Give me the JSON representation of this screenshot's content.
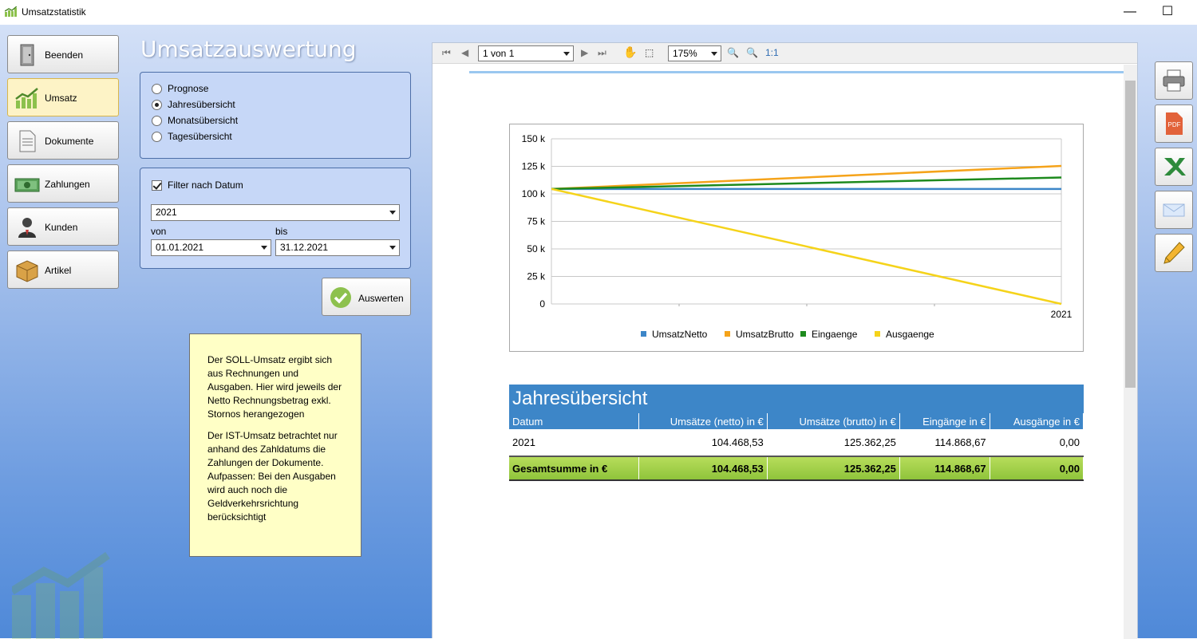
{
  "window": {
    "title": "Umsatzstatistik",
    "minimize_glyph": "—",
    "maximize_glyph": "☐"
  },
  "nav": {
    "items": [
      {
        "label": "Beenden",
        "icon": "exit-door-icon"
      },
      {
        "label": "Umsatz",
        "icon": "revenue-chart-icon"
      },
      {
        "label": "Dokumente",
        "icon": "document-icon"
      },
      {
        "label": "Zahlungen",
        "icon": "money-icon"
      },
      {
        "label": "Kunden",
        "icon": "user-icon"
      },
      {
        "label": "Artikel",
        "icon": "box-icon"
      }
    ]
  },
  "main": {
    "heading": "Umsatzauswertung",
    "report_type": {
      "options": [
        "Prognose",
        "Jahresübersicht",
        "Monatsübersicht",
        "Tagesübersicht"
      ],
      "selected": "Jahresübersicht"
    },
    "filter": {
      "checkbox_label": "Filter nach Datum",
      "checked": true,
      "year": "2021",
      "from_label": "von",
      "from_value": "01.01.2021",
      "to_label": "bis",
      "to_value": "31.12.2021"
    },
    "evaluate_label": "Auswerten",
    "note": {
      "p1": "Der SOLL-Umsatz ergibt sich aus Rechnungen und Ausgaben. Hier wird jeweils der Netto Rechnungsbetrag exkl. Stornos herangezogen",
      "p2": "Der IST-Umsatz betrachtet nur anhand des Zahldatums die Zahlungen der Dokumente. Aufpassen: Bei den Ausgaben wird auch noch die Geldverkehrsrichtung berücksichtigt"
    }
  },
  "viewer": {
    "page_indicator": "1 von 1",
    "zoom": "175%",
    "one_to_one": "1:1"
  },
  "chart_data": {
    "type": "line",
    "x": [
      "",
      "2021"
    ],
    "series": [
      {
        "name": "UmsatzNetto",
        "color": "#3d86c8",
        "values": [
          104468.53,
          104468.53
        ]
      },
      {
        "name": "UmsatzBrutto",
        "color": "#f5a31a",
        "values": [
          104468.53,
          125362.25
        ]
      },
      {
        "name": "Eingaenge",
        "color": "#1d8a1d",
        "values": [
          104468.53,
          114868.67
        ]
      },
      {
        "name": "Ausgaenge",
        "color": "#f5d31a",
        "values": [
          104468.53,
          0
        ]
      }
    ],
    "yticks": [
      "150 k",
      "125 k",
      "100 k",
      "75 k",
      "50 k",
      "25 k",
      "0"
    ],
    "ylim": [
      0,
      150000
    ],
    "grid": true,
    "legend": "bottom"
  },
  "report": {
    "title": "Jahresübersicht",
    "columns": [
      "Datum",
      "Umsätze (netto) in €",
      "Umsätze (brutto) in €",
      "Eingänge in €",
      "Ausgänge in €"
    ],
    "rows": [
      [
        "2021",
        "104.468,53",
        "125.362,25",
        "114.868,67",
        "0,00"
      ]
    ],
    "total": [
      "Gesamtsumme in €",
      "104.468,53",
      "125.362,25",
      "114.868,67",
      "0,00"
    ]
  },
  "side_actions": [
    {
      "name": "print-button",
      "icon": "printer-icon"
    },
    {
      "name": "pdf-export-button",
      "icon": "pdf-icon",
      "icon_text": "PDF"
    },
    {
      "name": "excel-export-button",
      "icon": "excel-icon"
    },
    {
      "name": "email-button",
      "icon": "envelope-icon"
    },
    {
      "name": "edit-button",
      "icon": "pencil-icon"
    }
  ]
}
